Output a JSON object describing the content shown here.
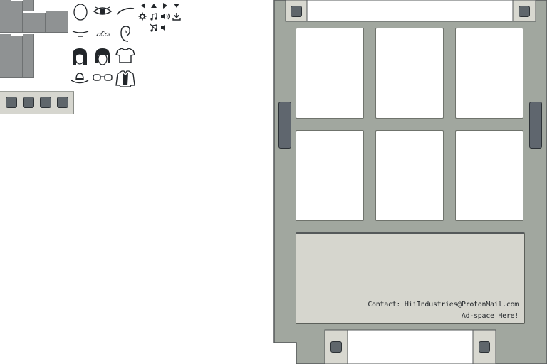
{
  "ad_panel": {
    "contact_text": "Contact: HiiIndustries@ProtonMail.com",
    "ad_link_text": "Ad-space Here!"
  },
  "colors": {
    "panel_bg": "#a1a79f",
    "panel_border": "#55595a",
    "card_bg": "#ffffff",
    "ad_bg": "#d6d6ce",
    "button_fill": "#5f666b",
    "sprite_gray": "#8f9293"
  },
  "icons": {
    "row1": [
      "head-outline-icon",
      "eye-icon",
      "eyebrow-icon"
    ],
    "row2": [
      "mouth-icon",
      "nose-icon",
      "ear-icon"
    ],
    "row3": [
      "hair-long-icon",
      "hair-bob-icon",
      "tshirt-icon"
    ],
    "row4": [
      "hat-icon",
      "glasses-icon",
      "jacket-icon"
    ],
    "controls": [
      "arrow-left-icon",
      "arrow-up-icon",
      "arrow-right-icon",
      "arrow-down-icon",
      "gear-icon",
      "music-icon",
      "volume-icon",
      "download-icon",
      "mute-music-icon",
      "mute-volume-icon"
    ]
  }
}
